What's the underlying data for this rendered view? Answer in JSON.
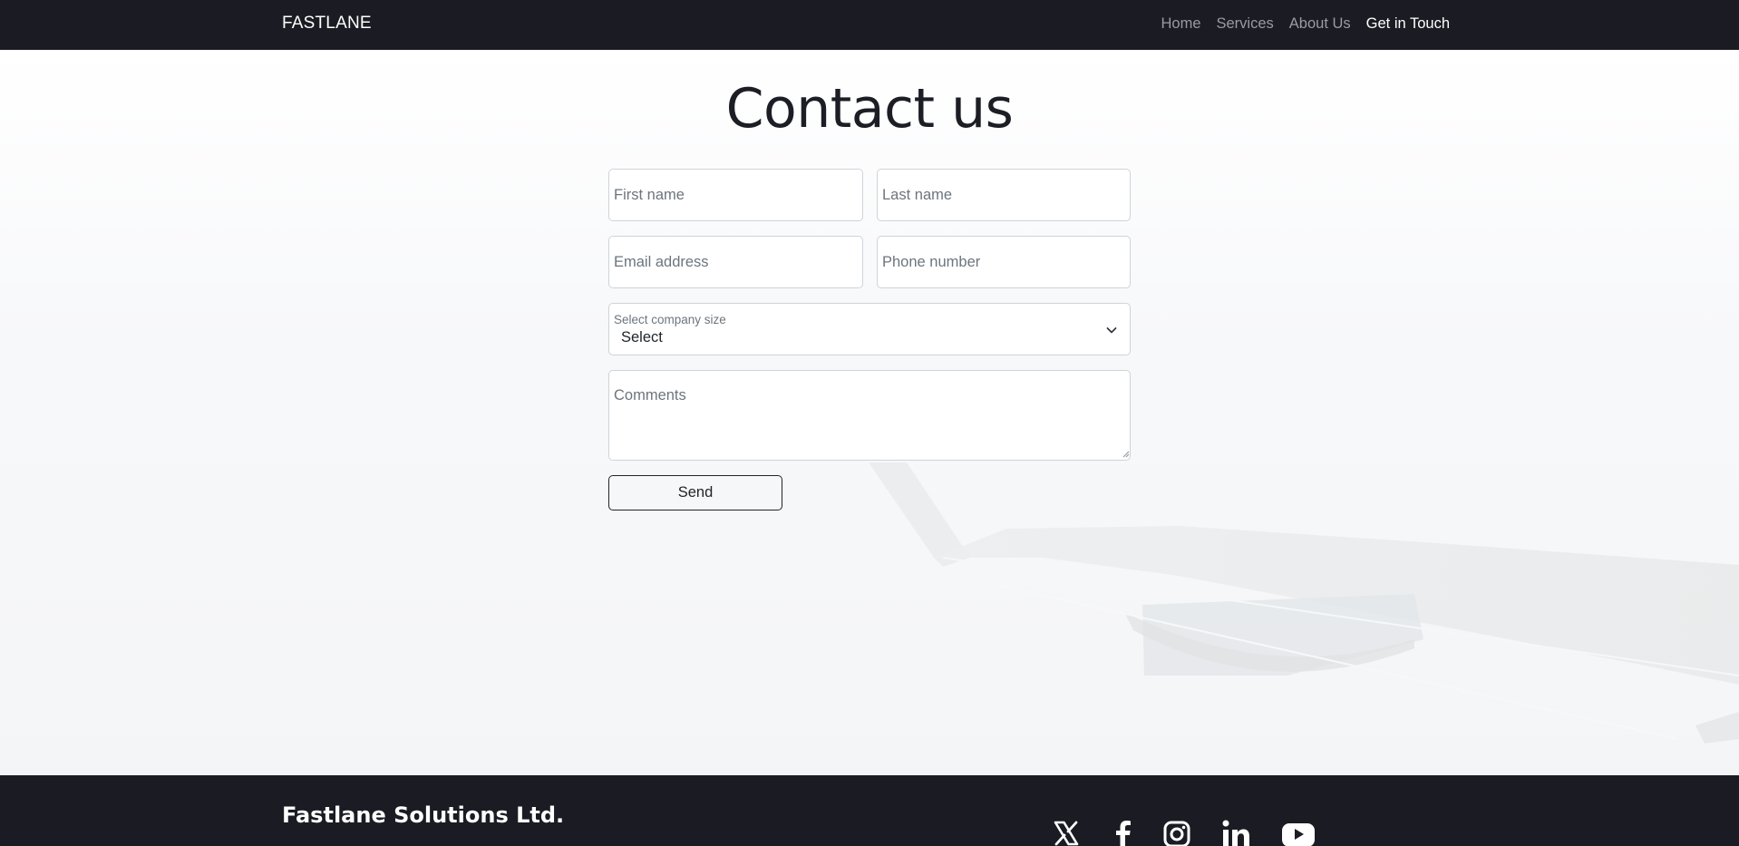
{
  "navbar": {
    "brand": "FASTLANE",
    "links": [
      {
        "label": "Home"
      },
      {
        "label": "Services"
      },
      {
        "label": "About Us"
      },
      {
        "label": "Get in Touch"
      }
    ]
  },
  "main": {
    "title": "Contact us",
    "form": {
      "first_name_placeholder": "First name",
      "last_name_placeholder": "Last name",
      "email_placeholder": "Email address",
      "phone_placeholder": "Phone number",
      "company_size_label": "Select company size",
      "company_size_value": "Select",
      "comments_placeholder": "Comments",
      "send_label": "Send"
    }
  },
  "footer": {
    "company": "Fastlane Solutions Ltd.",
    "social_icons": [
      "x-icon",
      "facebook-icon",
      "instagram-icon",
      "linkedin-icon",
      "youtube-icon"
    ]
  },
  "colors": {
    "navbar_bg": "#1b1c23",
    "nav_link": "#9a9ba1",
    "nav_active": "#ffffff"
  }
}
